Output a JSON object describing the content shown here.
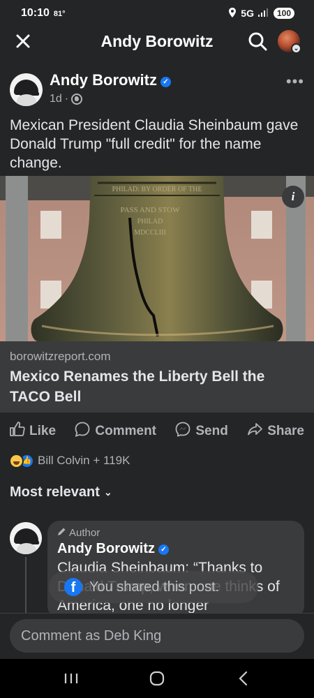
{
  "status_bar": {
    "time": "10:10",
    "temperature": "81°",
    "network": "5G",
    "battery": "100"
  },
  "nav": {
    "title": "Andy Borowitz"
  },
  "post": {
    "author": "Andy Borowitz",
    "time": "1d",
    "text": "Mexican President Claudia Sheinbaum gave Donald Trump \"full credit\" for the name change."
  },
  "link_preview": {
    "domain": "borowitzreport.com",
    "title": "Mexico Renames the Liberty Bell the TACO Bell"
  },
  "actions": {
    "like": "Like",
    "comment": "Comment",
    "send": "Send",
    "share": "Share"
  },
  "reactions": {
    "summary": "Bill Colvin + 119K"
  },
  "sort": {
    "label": "Most relevant"
  },
  "comment": {
    "tag": "Author",
    "name": "Andy Borowitz",
    "text": "Claudia Sheinbaum: “Thanks to Donald Trump, when one thinks of America, one no longer"
  },
  "toast": {
    "text": "You shared this post."
  },
  "composer": {
    "placeholder": "Comment as Deb King"
  },
  "colors": {
    "background": "#242526",
    "accent": "#1877f2",
    "card": "#3a3b3c"
  }
}
